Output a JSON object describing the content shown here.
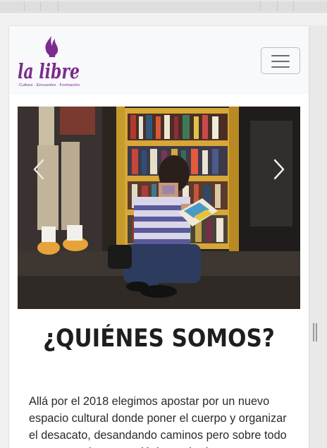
{
  "brand": {
    "logo_text": "la libre",
    "logo_tagline": "Cultura · Encuentro · Formación",
    "color_purple": "#7b2d8e"
  },
  "navbar": {
    "toggler_icon": "hamburger-menu-icon"
  },
  "carousel": {
    "prev_icon": "chevron-left-icon",
    "next_icon": "chevron-right-icon"
  },
  "main": {
    "heading": "¿QUIÉNES SOMOS?",
    "paragraph": "Allá por el 2018 elegimos apostar por un nuevo espacio cultural donde poner el cuerpo y organizar el desacato, desandando caminos pero sobre todo construyendo nuevas lógicas y horizontes."
  }
}
